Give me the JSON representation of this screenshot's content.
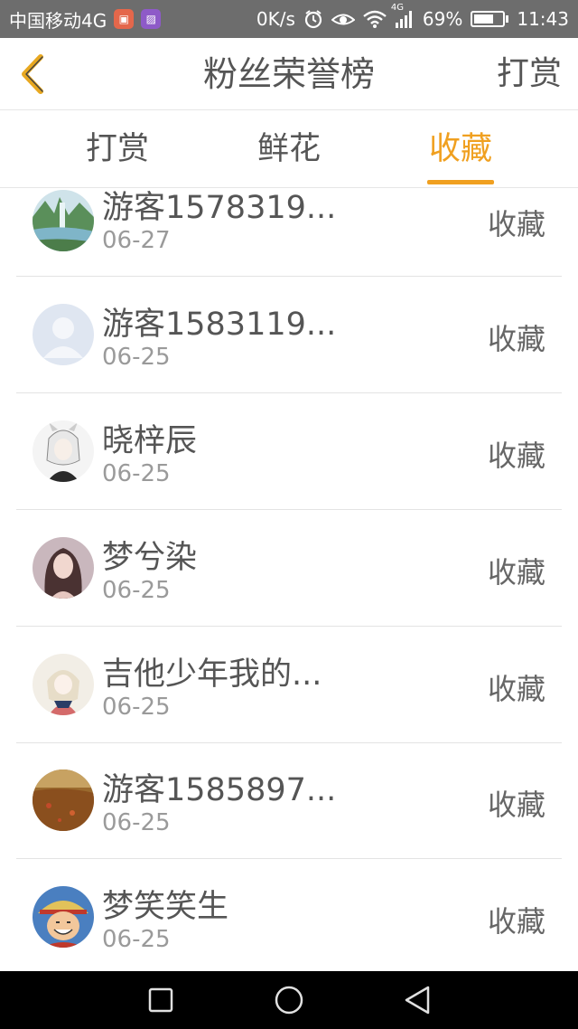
{
  "status_bar": {
    "carrier": "中国移动4G",
    "net_speed": "0K/s",
    "signal_type": "4G",
    "battery_percent": "69%",
    "battery_level": 0.69,
    "time": "11:43"
  },
  "header": {
    "title": "粉丝荣誉榜",
    "action_label": "打赏"
  },
  "tabs": [
    {
      "label": "打赏",
      "active": false
    },
    {
      "label": "鲜花",
      "active": false
    },
    {
      "label": "收藏",
      "active": true
    }
  ],
  "colors": {
    "accent": "#f0a020",
    "status_bar_bg": "#6d6d6d",
    "nav_bar_bg": "#000000"
  },
  "list": [
    {
      "name": "游客1578319...",
      "date": "06-27",
      "action": "收藏",
      "avatar": "landscape-waterfall"
    },
    {
      "name": "游客1583119...",
      "date": "06-25",
      "action": "收藏",
      "avatar": "default-user"
    },
    {
      "name": "晓梓辰",
      "date": "06-25",
      "action": "收藏",
      "avatar": "anime-character"
    },
    {
      "name": "梦兮染",
      "date": "06-25",
      "action": "收藏",
      "avatar": "woman-portrait"
    },
    {
      "name": "吉他少年我的...",
      "date": "06-25",
      "action": "收藏",
      "avatar": "illustrated-girl"
    },
    {
      "name": "游客1585897...",
      "date": "06-25",
      "action": "收藏",
      "avatar": "autumn-field"
    },
    {
      "name": "梦笑笑生",
      "date": "06-25",
      "action": "收藏",
      "avatar": "cartoon-pirate"
    }
  ],
  "nav_bar": {
    "buttons": [
      "recent-apps",
      "home",
      "back"
    ]
  }
}
